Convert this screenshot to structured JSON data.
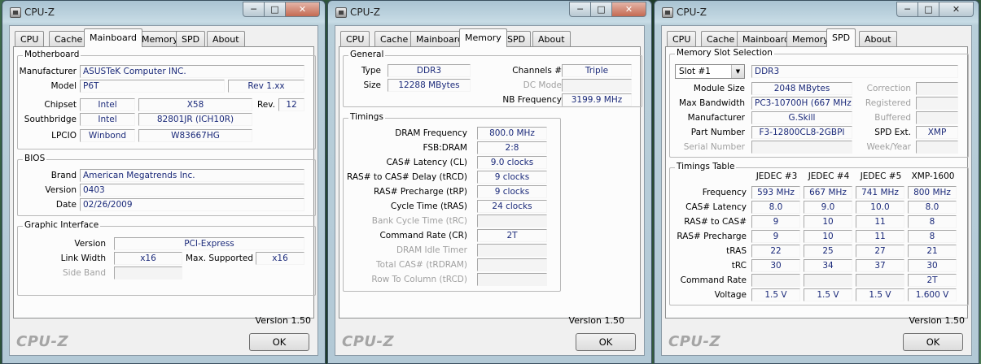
{
  "windows": [
    {
      "title": "CPU-Z",
      "tabs": [
        "CPU",
        "Cache",
        "Mainboard",
        "Memory",
        "SPD",
        "About"
      ],
      "active_tab": "Mainboard",
      "version": "Version 1.50",
      "brand": "CPU-Z",
      "ok": "OK",
      "motherboard": {
        "group": "Motherboard",
        "manufacturer_label": "Manufacturer",
        "manufacturer": "ASUSTeK Computer INC.",
        "model_label": "Model",
        "model": "P6T",
        "model_rev": "Rev 1.xx",
        "chipset_label": "Chipset",
        "chipset_vendor": "Intel",
        "chipset": "X58",
        "rev_label": "Rev.",
        "rev": "12",
        "southbridge_label": "Southbridge",
        "southbridge_vendor": "Intel",
        "southbridge": "82801JR (ICH10R)",
        "lpcio_label": "LPCIO",
        "lpcio_vendor": "Winbond",
        "lpcio": "W83667HG"
      },
      "bios": {
        "group": "BIOS",
        "brand_label": "Brand",
        "brand": "American Megatrends Inc.",
        "version_label": "Version",
        "version": "0403",
        "date_label": "Date",
        "date": "02/26/2009"
      },
      "graphic": {
        "group": "Graphic Interface",
        "version_label": "Version",
        "version": "PCI-Express",
        "link_width_label": "Link Width",
        "link_width": "x16",
        "max_supported_label": "Max. Supported",
        "max_supported": "x16",
        "side_band_label": "Side Band",
        "side_band": ""
      }
    },
    {
      "title": "CPU-Z",
      "tabs": [
        "CPU",
        "Cache",
        "Mainboard",
        "Memory",
        "SPD",
        "About"
      ],
      "active_tab": "Memory",
      "version": "Version 1.50",
      "brand": "CPU-Z",
      "ok": "OK",
      "general": {
        "group": "General",
        "type_label": "Type",
        "type": "DDR3",
        "size_label": "Size",
        "size": "12288 MBytes",
        "channels_label": "Channels #",
        "channels": "Triple",
        "dc_mode_label": "DC Mode",
        "dc_mode": "",
        "nb_freq_label": "NB Frequency",
        "nb_freq": "3199.9 MHz"
      },
      "timings": {
        "group": "Timings",
        "rows": [
          {
            "label": "DRAM Frequency",
            "value": "800.0 MHz",
            "disabled": false
          },
          {
            "label": "FSB:DRAM",
            "value": "2:8",
            "disabled": false
          },
          {
            "label": "CAS# Latency (CL)",
            "value": "9.0 clocks",
            "disabled": false
          },
          {
            "label": "RAS# to CAS# Delay (tRCD)",
            "value": "9 clocks",
            "disabled": false
          },
          {
            "label": "RAS# Precharge (tRP)",
            "value": "9 clocks",
            "disabled": false
          },
          {
            "label": "Cycle Time (tRAS)",
            "value": "24 clocks",
            "disabled": false
          },
          {
            "label": "Bank Cycle Time (tRC)",
            "value": "",
            "disabled": true
          },
          {
            "label": "Command Rate (CR)",
            "value": "2T",
            "disabled": false
          },
          {
            "label": "DRAM Idle Timer",
            "value": "",
            "disabled": true
          },
          {
            "label": "Total CAS# (tRDRAM)",
            "value": "",
            "disabled": true
          },
          {
            "label": "Row To Column (tRCD)",
            "value": "",
            "disabled": true
          }
        ]
      }
    },
    {
      "title": "CPU-Z",
      "tabs": [
        "CPU",
        "Cache",
        "Mainboard",
        "Memory",
        "SPD",
        "About"
      ],
      "active_tab": "SPD",
      "version": "Version 1.50",
      "brand": "CPU-Z",
      "ok": "OK",
      "slot": {
        "group": "Memory Slot Selection",
        "selected": "Slot #1",
        "type": "DDR3",
        "module_size_label": "Module Size",
        "module_size": "2048 MBytes",
        "max_bw_label": "Max Bandwidth",
        "max_bw": "PC3-10700H (667 MHz)",
        "manufacturer_label": "Manufacturer",
        "manufacturer": "G.Skill",
        "part_label": "Part Number",
        "part": "F3-12800CL8-2GBPI",
        "serial_label": "Serial Number",
        "serial": "",
        "correction_label": "Correction",
        "correction": "",
        "registered_label": "Registered",
        "registered": "",
        "buffered_label": "Buffered",
        "buffered": "",
        "spd_ext_label": "SPD Ext.",
        "spd_ext": "XMP",
        "week_label": "Week/Year",
        "week": ""
      },
      "timings_table": {
        "group": "Timings Table",
        "columns": [
          "JEDEC #3",
          "JEDEC #4",
          "JEDEC #5",
          "XMP-1600"
        ],
        "rows": [
          {
            "label": "Frequency",
            "values": [
              "593 MHz",
              "667 MHz",
              "741 MHz",
              "800 MHz"
            ]
          },
          {
            "label": "CAS# Latency",
            "values": [
              "8.0",
              "9.0",
              "10.0",
              "8.0"
            ]
          },
          {
            "label": "RAS# to CAS#",
            "values": [
              "9",
              "10",
              "11",
              "8"
            ]
          },
          {
            "label": "RAS# Precharge",
            "values": [
              "9",
              "10",
              "11",
              "8"
            ]
          },
          {
            "label": "tRAS",
            "values": [
              "22",
              "25",
              "27",
              "21"
            ]
          },
          {
            "label": "tRC",
            "values": [
              "30",
              "34",
              "37",
              "30"
            ]
          },
          {
            "label": "Command Rate",
            "values": [
              "",
              "",
              "",
              "2T"
            ]
          },
          {
            "label": "Voltage",
            "values": [
              "1.5 V",
              "1.5 V",
              "1.5 V",
              "1.600 V"
            ]
          }
        ]
      }
    }
  ]
}
